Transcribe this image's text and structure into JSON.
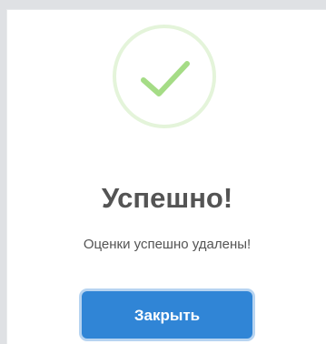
{
  "dialog": {
    "icon": "checkmark-success-icon",
    "title": "Успешно!",
    "message": "Оценки успешно удалены!",
    "confirm_label": "Закрыть"
  },
  "colors": {
    "success_green": "#a5dc86",
    "confirm_button": "#3085d6",
    "text": "#545454"
  }
}
